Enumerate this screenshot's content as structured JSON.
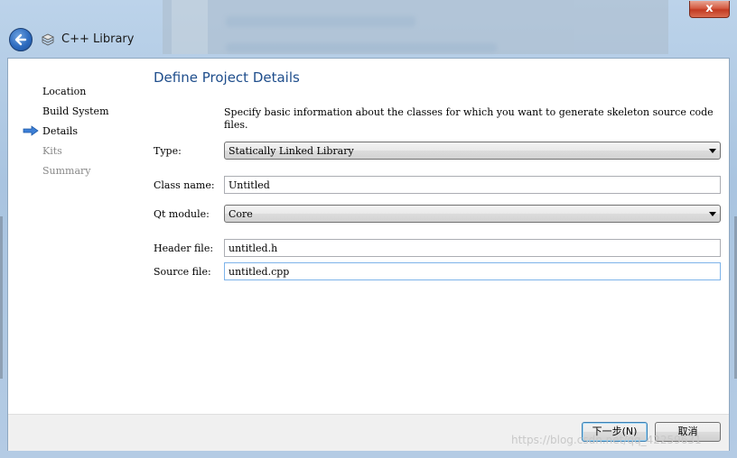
{
  "window": {
    "title": "C++ Library",
    "close_glyph": "x"
  },
  "steps": [
    {
      "label": "Location",
      "state": "done"
    },
    {
      "label": "Build System",
      "state": "done"
    },
    {
      "label": "Details",
      "state": "current"
    },
    {
      "label": "Kits",
      "state": "pending"
    },
    {
      "label": "Summary",
      "state": "pending"
    }
  ],
  "page": {
    "title": "Define Project Details",
    "description": "Specify basic information about the classes for which you want to generate skeleton source code files."
  },
  "form": {
    "type_label": "Type:",
    "type_value": "Statically Linked Library",
    "class_name_label": "Class name:",
    "class_name_value": "Untitled",
    "qt_module_label": "Qt module:",
    "qt_module_value": "Core",
    "header_file_label": "Header file:",
    "header_file_value": "untitled.h",
    "source_file_label": "Source file:",
    "source_file_value": "untitled.cpp"
  },
  "buttons": {
    "next": "下一步(N)",
    "cancel": "取消"
  },
  "watermark": "https://blog.csdn.net/qq_42259631",
  "colors": {
    "title_blue": "#1f4e8c",
    "arrow_blue": "#3d7fd6",
    "close_red": "#c23b22"
  },
  "icons": {
    "back": "back-arrow-icon",
    "library": "library-icon",
    "current_step": "right-arrow-icon"
  }
}
